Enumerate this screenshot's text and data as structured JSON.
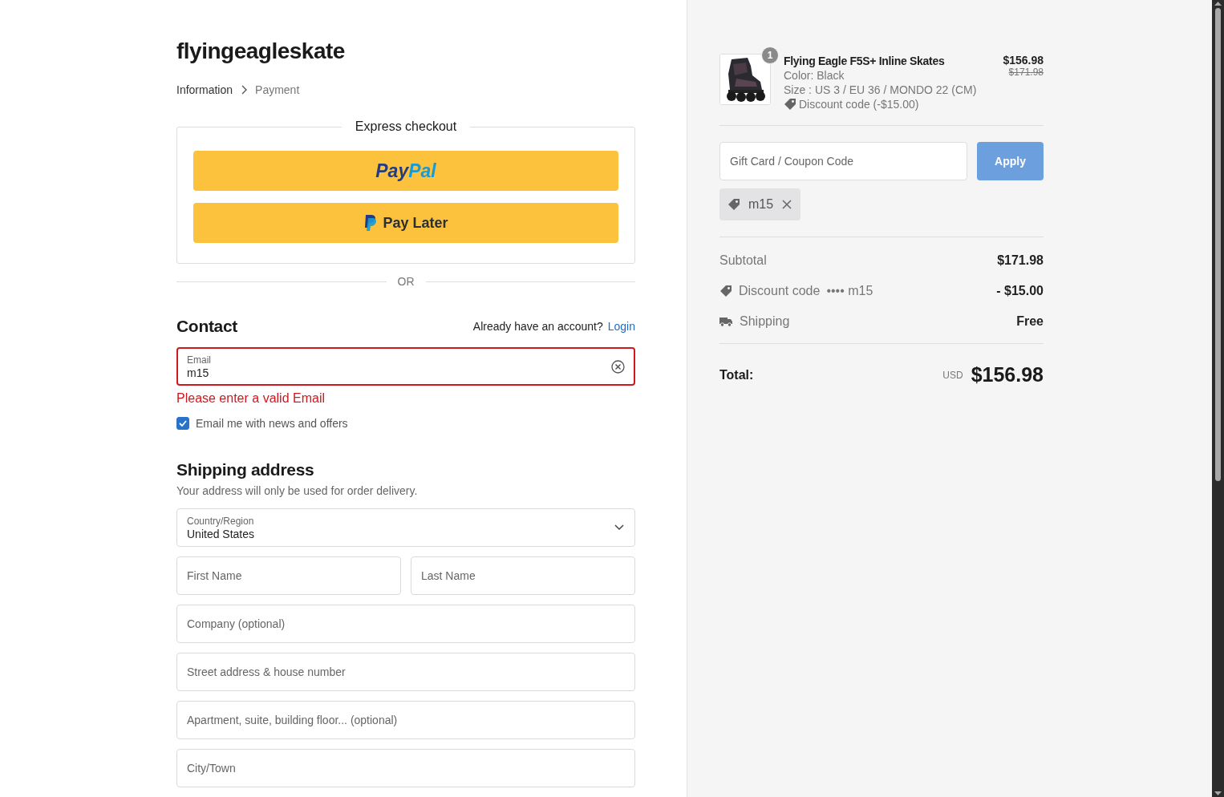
{
  "store_name": "flyingeagleskate",
  "breadcrumb": [
    {
      "label": "Information",
      "selected": true
    },
    {
      "label": "Payment",
      "selected": false
    }
  ],
  "express_checkout": {
    "title": "Express checkout",
    "buttons": [
      {
        "kind": "paypal",
        "label_parts": [
          "Pay",
          "Pal"
        ]
      },
      {
        "kind": "pay_later",
        "label": "Pay Later"
      }
    ]
  },
  "divider_text": "OR",
  "contact": {
    "heading": "Contact",
    "account_prompt": "Already have an account?",
    "login_link": "Login",
    "email": {
      "label": "Email",
      "value": "m15",
      "invalid": true
    },
    "error": "Please enter a valid Email",
    "newsletter": {
      "label": "Email me with news and offers",
      "checked": true
    }
  },
  "shipping": {
    "heading": "Shipping address",
    "note": "Your address will only be used for order delivery.",
    "rows": [
      [
        {
          "kind": "select",
          "label": "Country/Region",
          "value": "United States"
        }
      ],
      [
        {
          "kind": "text",
          "placeholder": "First Name"
        },
        {
          "kind": "text",
          "placeholder": "Last Name"
        }
      ],
      [
        {
          "kind": "text",
          "placeholder": "Company (optional)"
        }
      ],
      [
        {
          "kind": "text",
          "placeholder": "Street address & house number"
        }
      ],
      [
        {
          "kind": "text",
          "placeholder": "Apartment, suite, building floor... (optional)"
        }
      ],
      [
        {
          "kind": "text",
          "placeholder": "City/Town"
        }
      ]
    ]
  },
  "summary": {
    "items": [
      {
        "quantity": "1",
        "name": "Flying Eagle F5S+ Inline Skates",
        "details": [
          "Color: Black",
          "Size : US 3 / EU 36 / MONDO 22 (CM)"
        ],
        "discount": "Discount code (-$15.00)",
        "price": "$156.98",
        "original_price": "$171.98"
      }
    ],
    "coupon": {
      "placeholder": "Gift Card / Coupon Code",
      "button": "Apply"
    },
    "applied_codes": [
      {
        "code": "m15"
      }
    ],
    "lines": [
      {
        "kind": "subtotal",
        "label": "Subtotal",
        "value": "$171.98"
      },
      {
        "kind": "discount",
        "label": "Discount code",
        "code": "•••• m15",
        "value": "- $15.00"
      },
      {
        "kind": "shipping",
        "label": "Shipping",
        "value": "Free"
      }
    ],
    "total": {
      "label": "Total:",
      "currency": "USD",
      "value": "$156.98"
    }
  }
}
